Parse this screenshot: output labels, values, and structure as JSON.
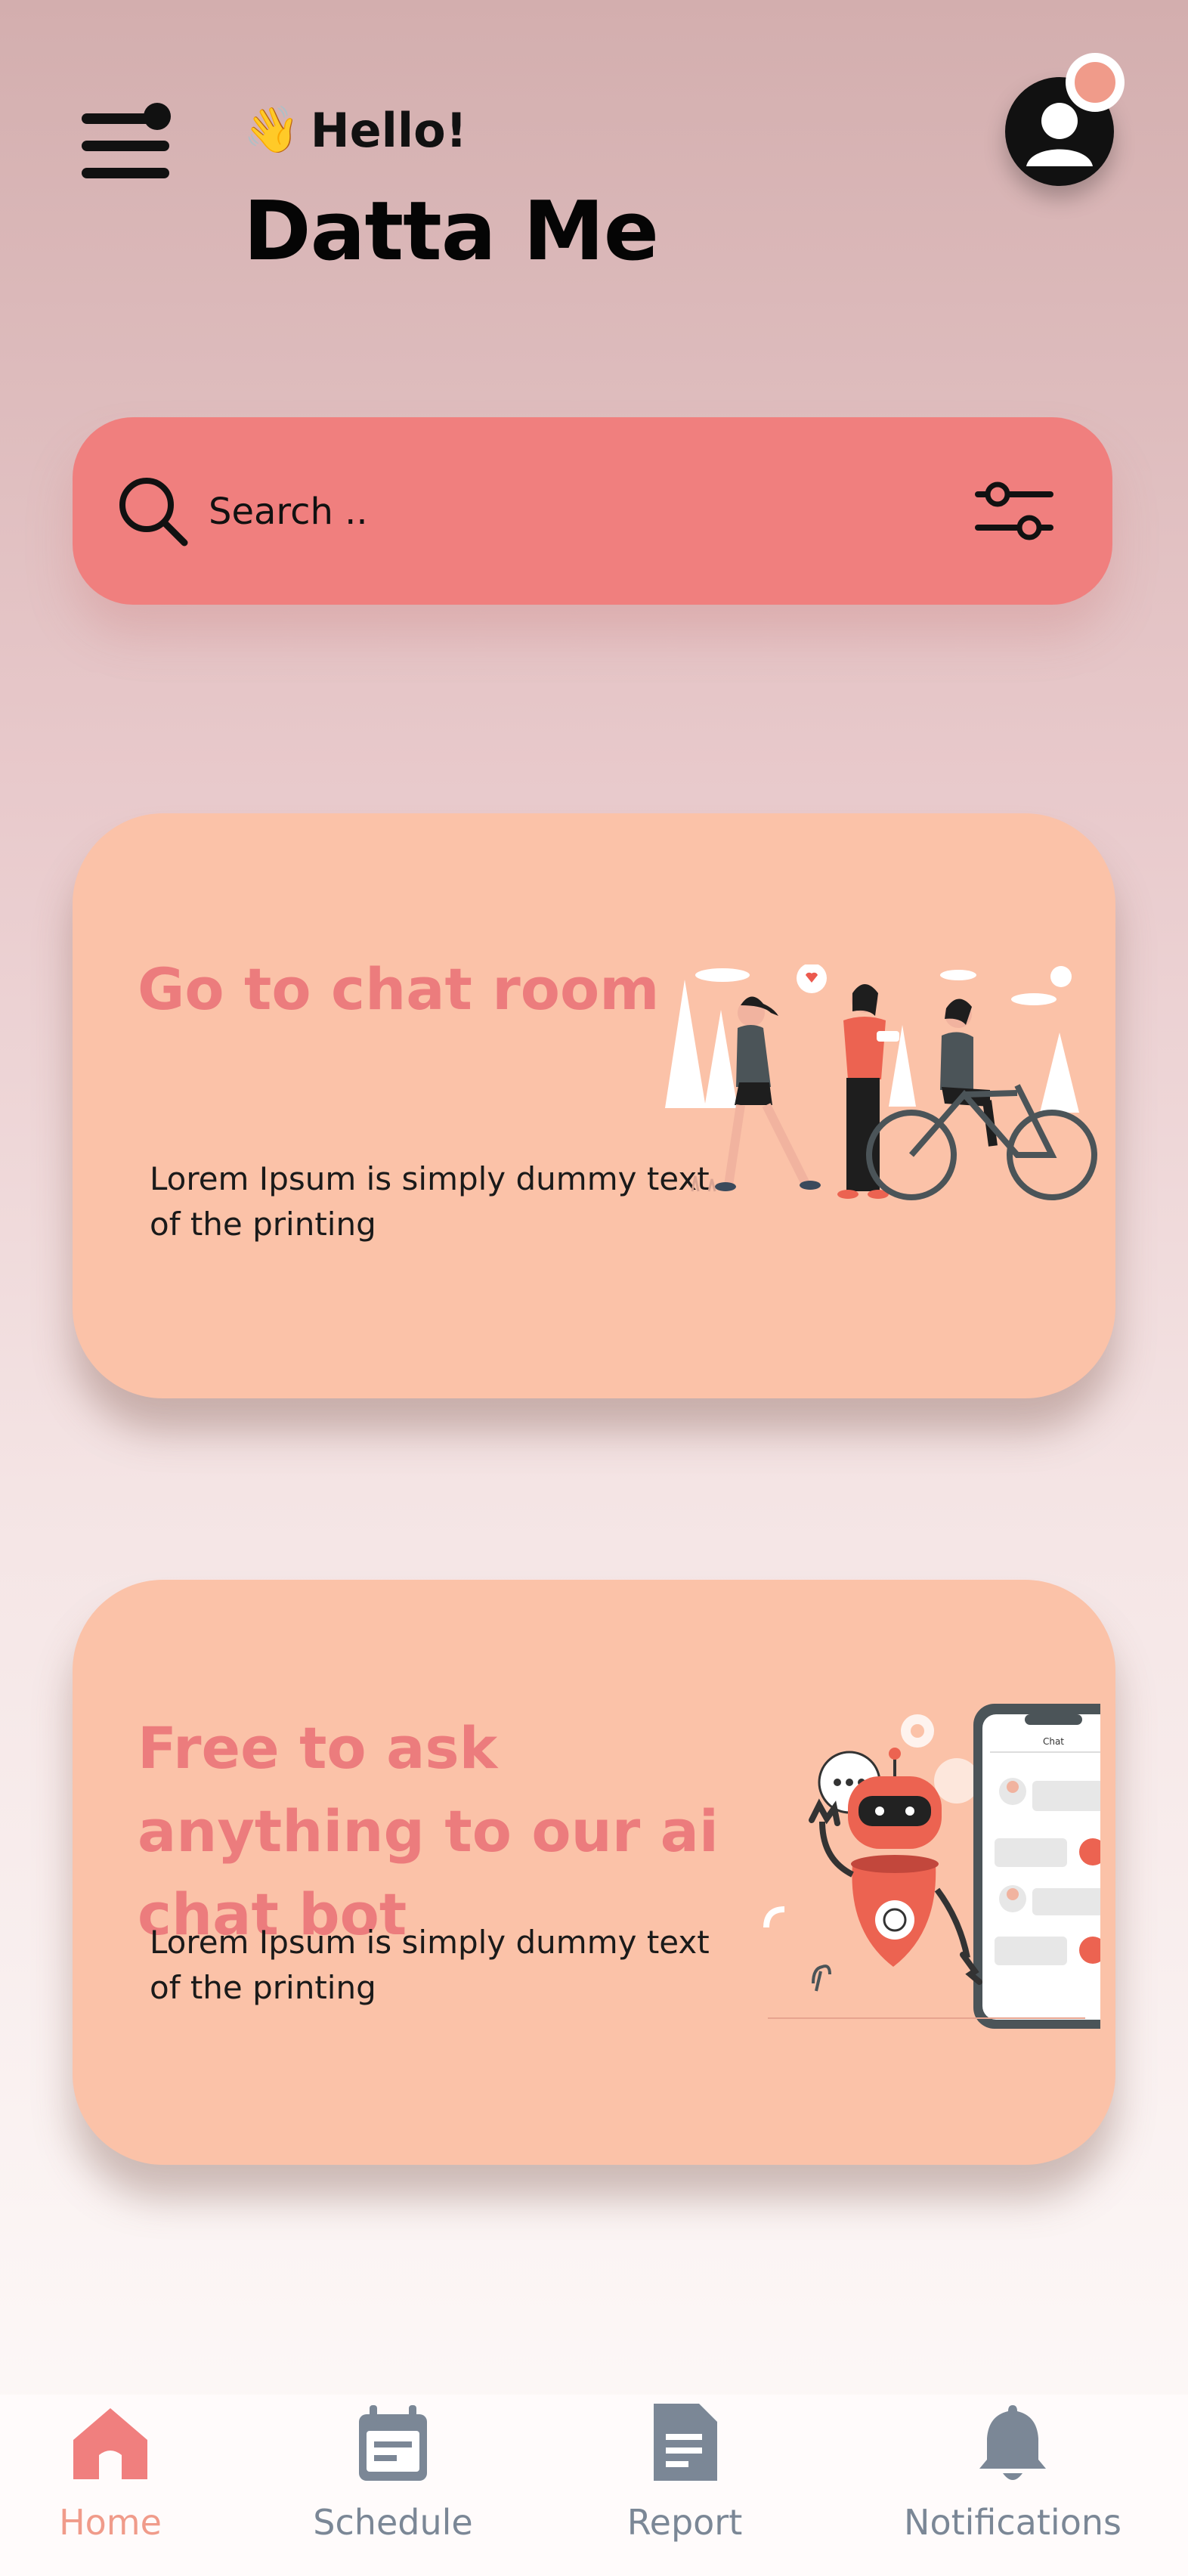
{
  "header": {
    "greeting_emoji": "👋",
    "greeting": "Hello!",
    "username": "Datta Me"
  },
  "search": {
    "placeholder": "Search .."
  },
  "cards": [
    {
      "title": "Go to chat room",
      "description": "Lorem Ipsum is simply dummy text of the printing"
    },
    {
      "title": "Free to ask anything to our ai chat bot",
      "description": "Lorem Ipsum is simply dummy text of the printing",
      "phone_header": "Chat"
    }
  ],
  "nav": {
    "items": [
      {
        "label": "Home",
        "icon": "home-icon",
        "active": true
      },
      {
        "label": "Schedule",
        "icon": "calendar-icon",
        "active": false
      },
      {
        "label": "Report",
        "icon": "document-icon",
        "active": false
      },
      {
        "label": "Notifications",
        "icon": "bell-icon",
        "active": false
      }
    ]
  },
  "colors": {
    "accent": "#f07f7e",
    "card_bg": "#fbc2a8",
    "card_title": "#ec7c7d",
    "nav_active": "#f09b8a",
    "nav_inactive": "#7b8796"
  }
}
